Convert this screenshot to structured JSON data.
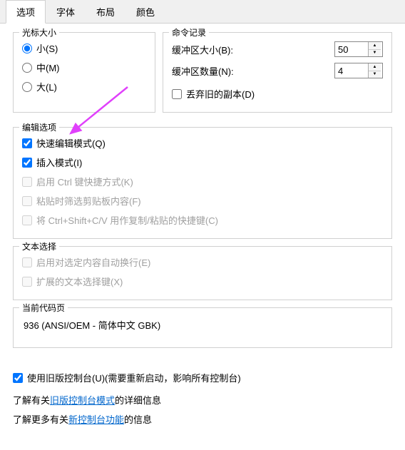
{
  "tabs": {
    "options": "选项",
    "font": "字体",
    "layout": "布局",
    "colors": "颜色"
  },
  "cursor": {
    "title": "光标大小",
    "small": "小(S)",
    "medium": "中(M)",
    "large": "大(L)"
  },
  "cmdhist": {
    "title": "命令记录",
    "bufsize_label": "缓冲区大小(B):",
    "bufsize_value": "50",
    "bufnum_label": "缓冲区数量(N):",
    "bufnum_value": "4",
    "discard_label": "丢弃旧的副本(D)"
  },
  "edit": {
    "title": "编辑选项",
    "quickedit": "快速编辑模式(Q)",
    "insert": "插入模式(I)",
    "ctrlkeys": "启用 Ctrl 键快捷方式(K)",
    "filterpaste": "粘贴时筛选剪贴板内容(F)",
    "ctrlshift": "将 Ctrl+Shift+C/V 用作复制/粘贴的快捷键(C)"
  },
  "textsel": {
    "title": "文本选择",
    "linewrap": "启用对选定内容自动换行(E)",
    "extended": "扩展的文本选择键(X)"
  },
  "codepage": {
    "title": "当前代码页",
    "value": "936   (ANSI/OEM - 简体中文 GBK)"
  },
  "bottom": {
    "legacy_checkbox": "使用旧版控制台(U)(需要重新启动，影响所有控制台)",
    "learn_prefix": "了解有关",
    "legacy_link": "旧版控制台模式",
    "learn_suffix": "的详细信息",
    "learn2_prefix": "了解更多有关",
    "newconsole_link": "新控制台功能",
    "learn2_suffix": "的信息"
  },
  "arrow_color": "#e040fb"
}
